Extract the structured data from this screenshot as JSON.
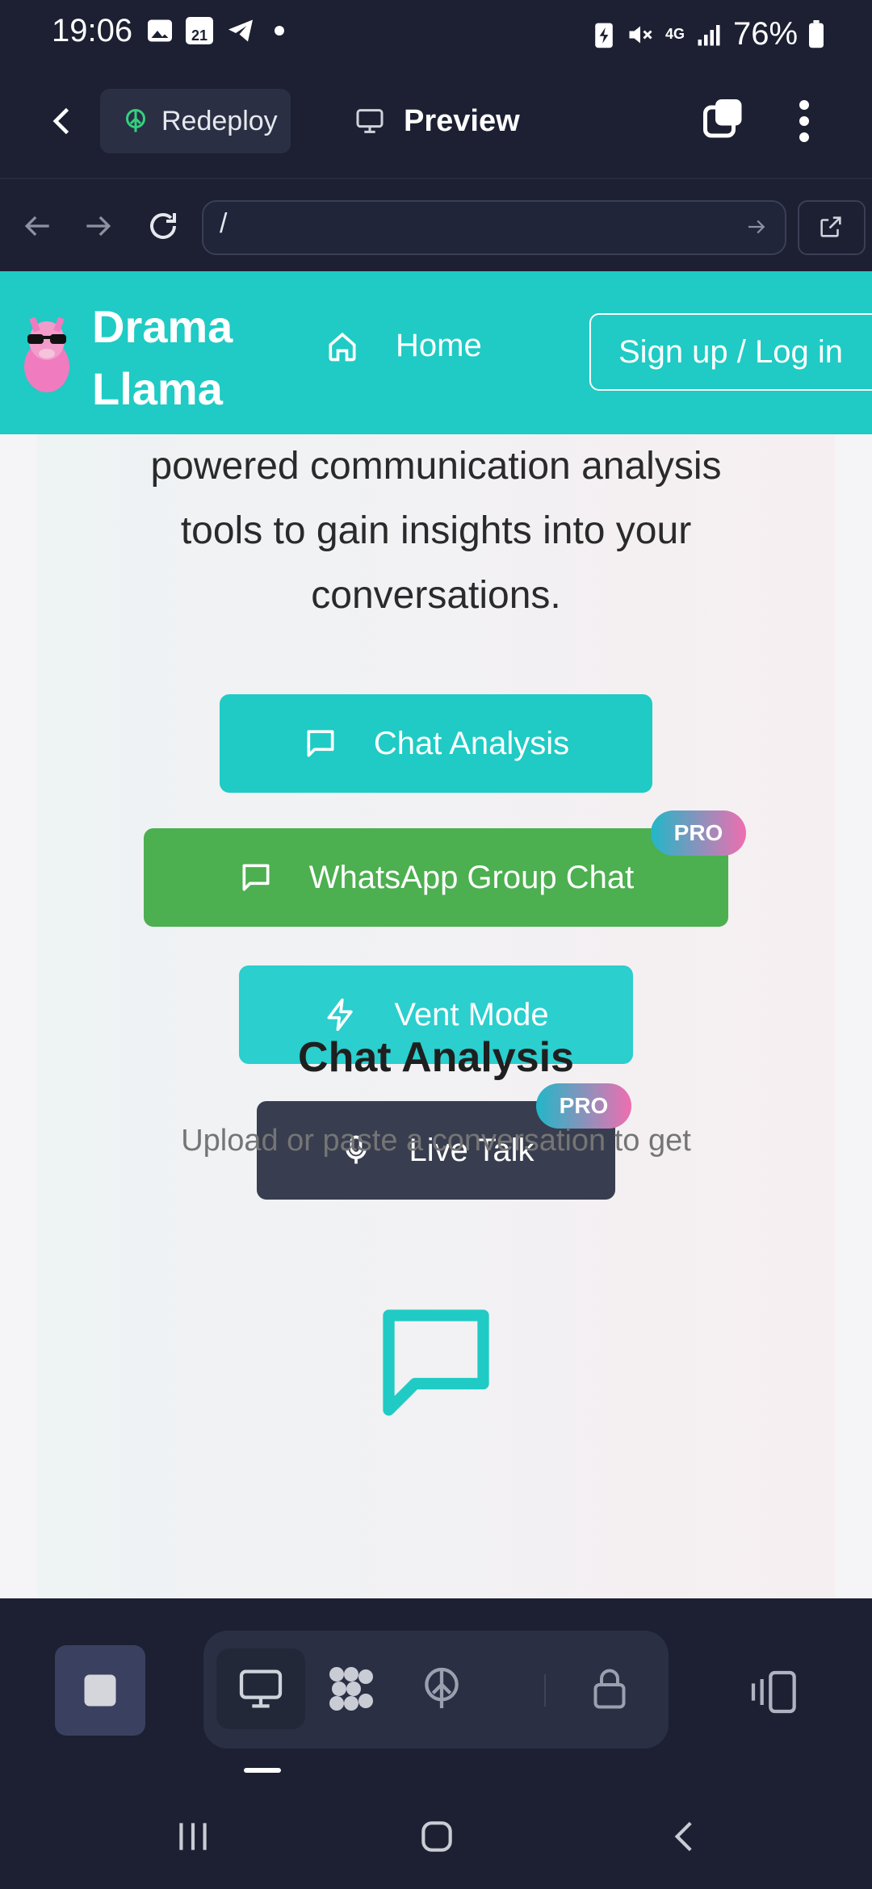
{
  "status": {
    "time": "19:06",
    "calendar_day": "21",
    "network": "4G",
    "battery": "76%"
  },
  "appbar": {
    "redeploy_label": "Redeploy",
    "preview_label": "Preview"
  },
  "browser": {
    "url": "/"
  },
  "site": {
    "brand_line1": "Drama",
    "brand_line2": "Llama",
    "nav_home": "Home",
    "signup_label": "Sign up / Log in"
  },
  "intro": {
    "line1": "powered communication analysis",
    "line2": "tools to gain insights into your",
    "line3": "conversations."
  },
  "actions": {
    "chat_analysis": "Chat Analysis",
    "whatsapp": "WhatsApp Group Chat",
    "vent": "Vent Mode",
    "live_talk": "Live Talk",
    "pro_badge": "PRO"
  },
  "feature": {
    "title": "Chat Analysis",
    "desc": "Upload or paste a conversation to get"
  },
  "colors": {
    "teal": "#1fcbc4",
    "green": "#4caf50",
    "dark_button": "#383e4f",
    "background_dark": "#1c2032"
  }
}
